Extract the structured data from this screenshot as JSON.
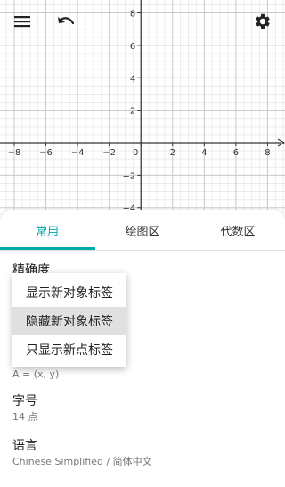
{
  "toolbar": {
    "menu_icon": "hamburger-menu-icon",
    "undo_icon": "undo-icon",
    "settings_icon": "gear-icon"
  },
  "graph": {
    "x_ticks": [
      "−8",
      "−6",
      "−4",
      "−2",
      "0",
      "2",
      "4",
      "6",
      "8"
    ],
    "y_ticks": [
      "8",
      "6",
      "4",
      "2",
      "−2",
      "−4"
    ],
    "x_range": [
      -8.9,
      9.1
    ],
    "y_range": [
      -4.4,
      8.8
    ],
    "grid": true
  },
  "tabs": [
    {
      "label": "常用",
      "active": true
    },
    {
      "label": "绘图区",
      "active": false
    },
    {
      "label": "代数区",
      "active": false
    }
  ],
  "settings": {
    "precision": {
      "title": "精确度"
    },
    "labeling": {
      "value": "A = (x, y)"
    },
    "font_size": {
      "title": "字号",
      "value": "14 点"
    },
    "language": {
      "title": "语言",
      "value": "Chinese Simplified / 简体中文"
    }
  },
  "popup": {
    "items": [
      {
        "label": "显示新对象标签",
        "selected": false
      },
      {
        "label": "隐藏新对象标签",
        "selected": true
      },
      {
        "label": "只显示新点标签",
        "selected": false
      }
    ]
  },
  "colors": {
    "accent": "#00a8a8",
    "axis": "#333333",
    "grid_major": "#c8c8c8",
    "grid_minor": "#ececec"
  }
}
